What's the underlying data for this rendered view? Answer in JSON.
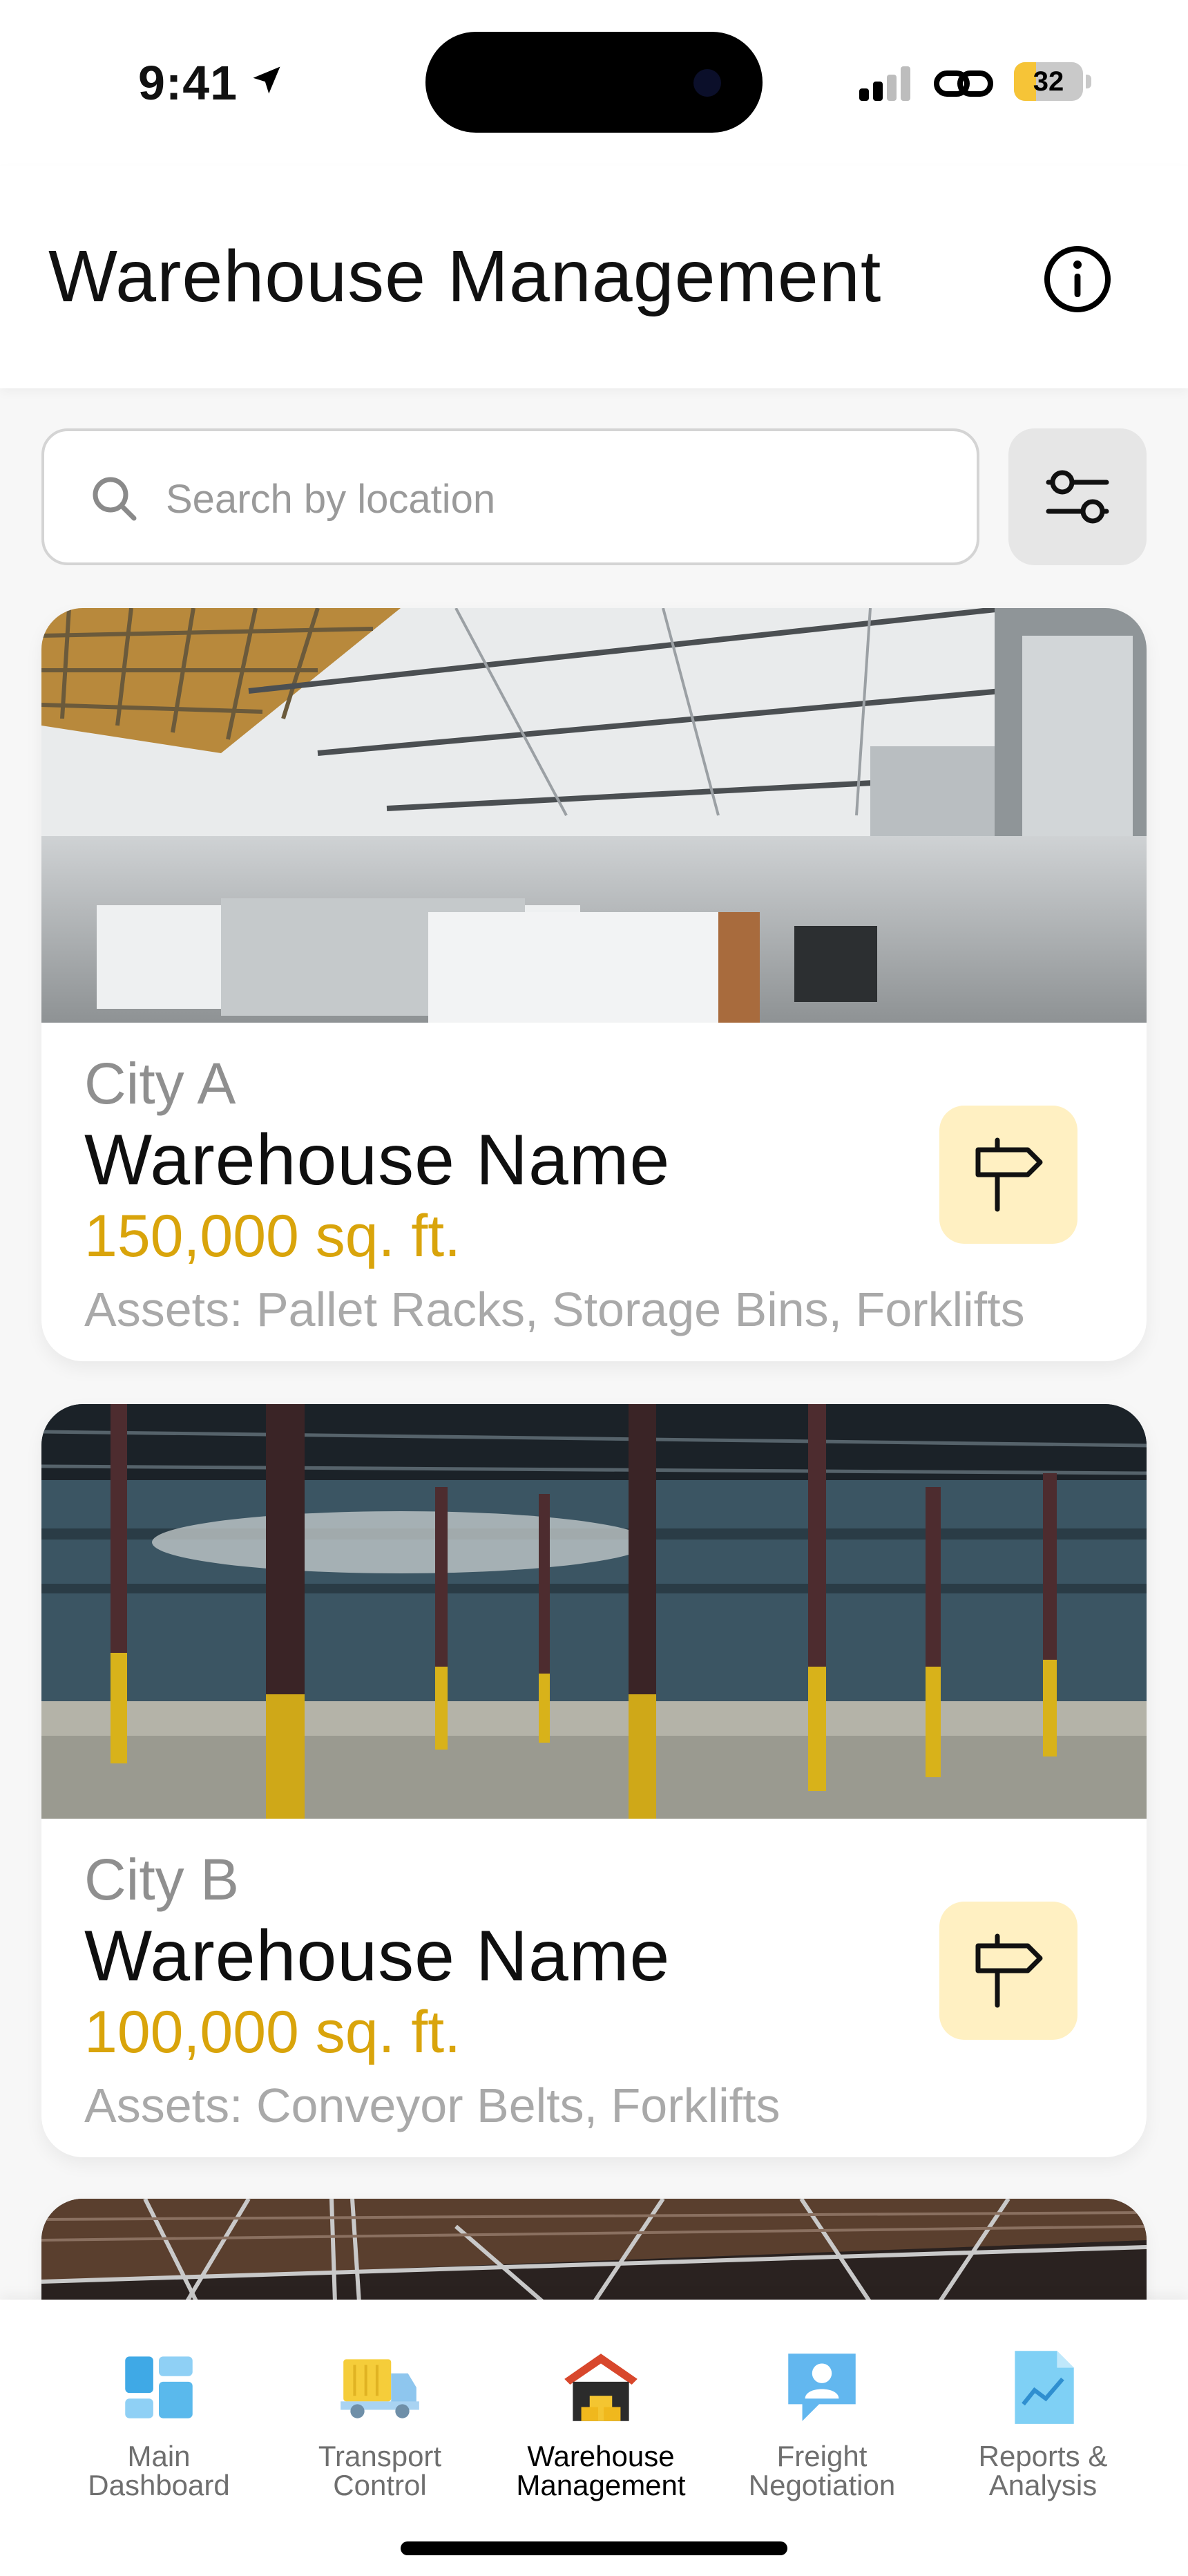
{
  "status_bar": {
    "time": "9:41",
    "battery_level": "32",
    "battery_fraction": 0.32,
    "location_icon": "location-arrow-icon",
    "signal_icon": "cellular-signal-icon",
    "link_icon": "link-icon"
  },
  "header": {
    "title": "Warehouse Management",
    "info_icon": "info-icon"
  },
  "search": {
    "placeholder": "Search by location",
    "value": "",
    "filter_icon": "filter-sliders-icon"
  },
  "colors": {
    "accent": "#d9a40b",
    "direction_button_bg": "#fff0c2",
    "muted_text": "#8f8f8f"
  },
  "warehouses": [
    {
      "city": "City A",
      "name": "Warehouse Name",
      "size": "150,000 sq. ft.",
      "assets": "Assets: Pallet Racks, Storage Bins, Forklifts",
      "image": "office-warehouse-interior-photo",
      "action_icon": "signpost-directions-icon"
    },
    {
      "city": "City B",
      "name": "Warehouse Name",
      "size": "100,000 sq. ft.",
      "assets": "Assets: Conveyor Belts, Forklifts",
      "image": "empty-warehouse-yellow-pillars-photo",
      "action_icon": "signpost-directions-icon"
    },
    {
      "image": "warehouse-steel-roof-trusses-photo"
    }
  ],
  "tabbar": {
    "items": [
      {
        "label": "Main\nDashboard",
        "icon": "dashboard-grid-icon",
        "active": false
      },
      {
        "label": "Transport\nControl",
        "icon": "delivery-truck-icon",
        "active": false
      },
      {
        "label": "Warehouse\nManagement",
        "icon": "warehouse-icon",
        "active": true
      },
      {
        "label": "Freight\nNegotiation",
        "icon": "chat-person-icon",
        "active": false
      },
      {
        "label": "Reports &\nAnalysis",
        "icon": "report-chart-icon",
        "active": false
      }
    ]
  }
}
